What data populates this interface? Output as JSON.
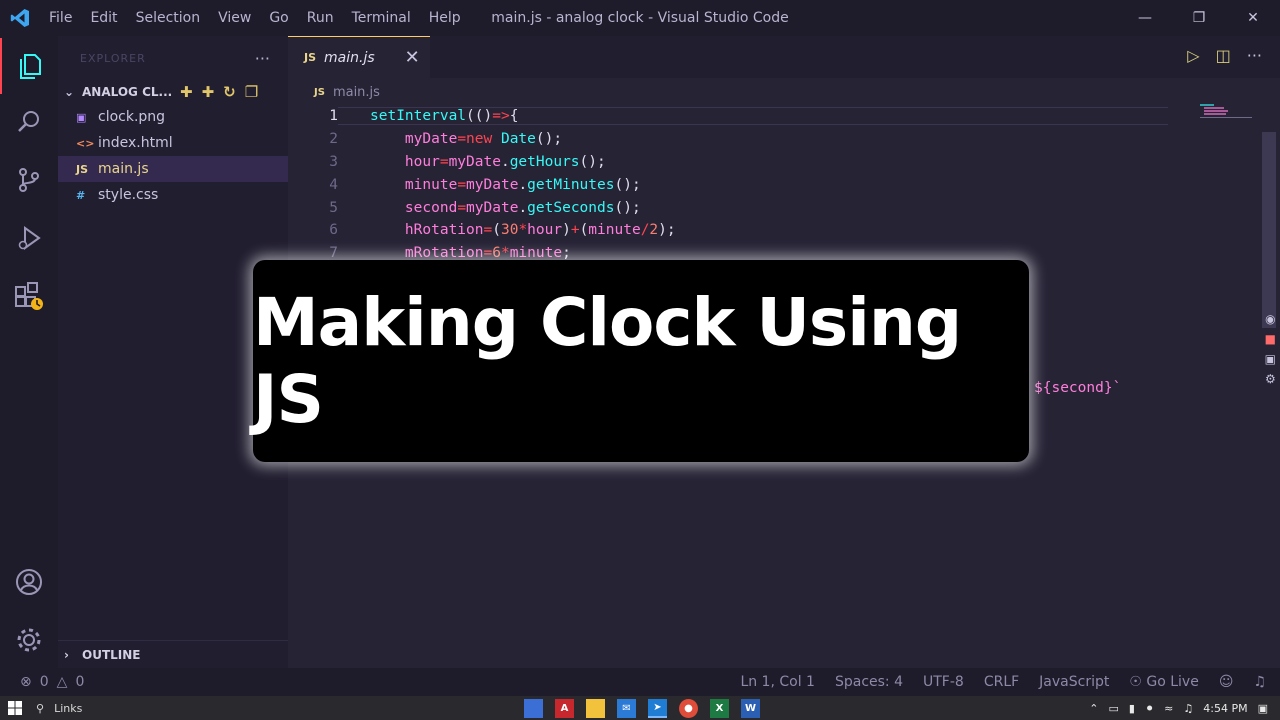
{
  "window": {
    "title": "main.js - analog clock - Visual Studio Code",
    "menu": [
      "File",
      "Edit",
      "Selection",
      "View",
      "Go",
      "Run",
      "Terminal",
      "Help"
    ]
  },
  "sidebar": {
    "header": "EXPLORER",
    "folder": "ANALOG CL...",
    "files": [
      {
        "name": "clock.png",
        "icon": "image-icon"
      },
      {
        "name": "index.html",
        "icon": "html-icon"
      },
      {
        "name": "main.js",
        "icon": "js-icon",
        "selected": true
      },
      {
        "name": "style.css",
        "icon": "css-icon"
      }
    ],
    "outline": "OUTLINE"
  },
  "editor": {
    "tab_label": "main.js",
    "tab_icon_text": "JS",
    "breadcrumb": "main.js",
    "line_numbers": [
      "1",
      "2",
      "3",
      "4",
      "5",
      "6",
      "7"
    ],
    "stray_text": "${second}`"
  },
  "banner": {
    "text": "Making Clock Using JS"
  },
  "statusbar": {
    "errors": "0",
    "warnings": "0",
    "position": "Ln 1, Col 1",
    "spaces": "Spaces: 4",
    "encoding": "UTF-8",
    "eol": "CRLF",
    "language": "JavaScript",
    "golive": "Go Live"
  },
  "taskbar": {
    "search_label": "Links",
    "time": "4:54 PM"
  },
  "colors": {
    "accent": "#fe4450",
    "tab_border": "#ffcc66",
    "function": "#36f9f6",
    "variable": "#ff7edb",
    "operator": "#fede5d"
  }
}
